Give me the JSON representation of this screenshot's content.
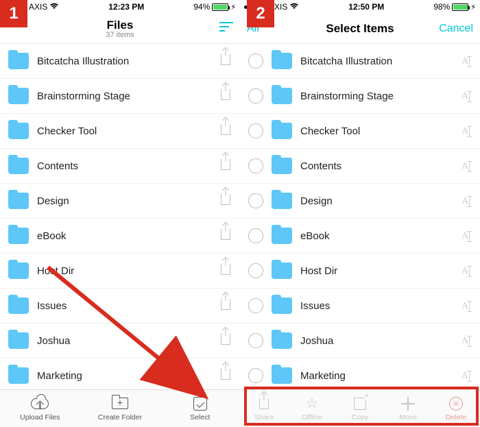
{
  "annotations": {
    "badge1": "1",
    "badge2": "2"
  },
  "screen1": {
    "status": {
      "carrier": "AXIS",
      "time": "12:23 PM",
      "battery_pct": "94%"
    },
    "nav": {
      "title": "Files",
      "subtitle": "37 items"
    },
    "folders": [
      {
        "name": "Bitcatcha Illustration"
      },
      {
        "name": "Brainstorming Stage"
      },
      {
        "name": "Checker Tool"
      },
      {
        "name": "Contents"
      },
      {
        "name": "Design"
      },
      {
        "name": "eBook"
      },
      {
        "name": "Host Dir"
      },
      {
        "name": "Issues"
      },
      {
        "name": "Joshua"
      },
      {
        "name": "Marketing"
      }
    ],
    "tabs": {
      "upload": "Upload Files",
      "create": "Create Folder",
      "select": "Select"
    }
  },
  "screen2": {
    "status": {
      "carrier": "AXIS",
      "time": "12:50 PM",
      "battery_pct": "98%"
    },
    "nav": {
      "left": "All",
      "title": "Select Items",
      "right": "Cancel"
    },
    "folders": [
      {
        "name": "Bitcatcha Illustration"
      },
      {
        "name": "Brainstorming Stage"
      },
      {
        "name": "Checker Tool"
      },
      {
        "name": "Contents"
      },
      {
        "name": "Design"
      },
      {
        "name": "eBook"
      },
      {
        "name": "Host Dir"
      },
      {
        "name": "Issues"
      },
      {
        "name": "Joshua"
      },
      {
        "name": "Marketing"
      }
    ],
    "tabs": {
      "share": "Share",
      "offline": "Offline",
      "copy": "Copy",
      "move": "Move",
      "delete": "Delete"
    }
  }
}
